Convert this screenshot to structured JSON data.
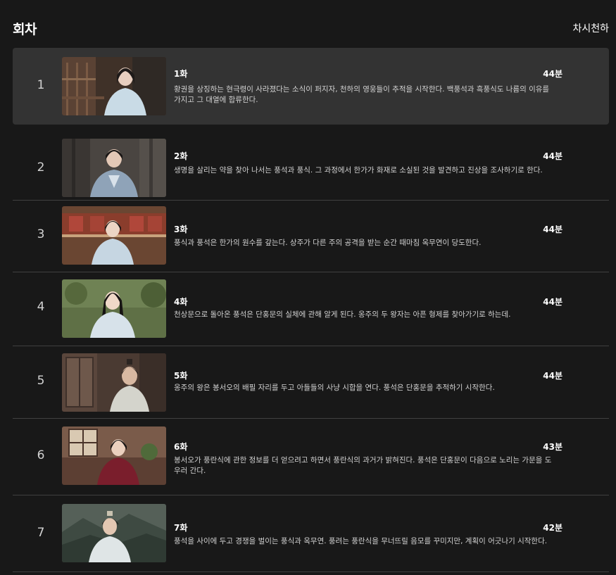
{
  "header": {
    "title": "회차",
    "show_title": "차시천하"
  },
  "episodes": [
    {
      "number": "1",
      "title": "1화",
      "duration": "44분",
      "description": "황권을 상징하는 현극령이 사라졌다는 소식이 퍼지자, 천하의 영웅들이 추적을 시작한다. 백풍석과 흑풍식도 나름의 이유를 가지고 그 대열에 합류한다.",
      "thumbnail": "woman-in-light-blue-robe-on-wooden-veranda"
    },
    {
      "number": "2",
      "title": "2화",
      "duration": "44분",
      "description": "생명을 살리는 약을 찾아 나서는 풍석과 풍식. 그 과정에서 한가가 화재로 소실된 것을 발견하고 진상을 조사하기로 한다.",
      "thumbnail": "man-in-grey-blue-robe-in-forest"
    },
    {
      "number": "3",
      "title": "3화",
      "duration": "44분",
      "description": "풍식과 풍석은 한가의 원수를 갚는다. 상주가 다른 주의 공격을 받는 순간 때마침 옥무연이 당도한다.",
      "thumbnail": "woman-in-light-blue-robe-before-red-building"
    },
    {
      "number": "4",
      "title": "4화",
      "duration": "44분",
      "description": "천상문으로 돌아온 풍석은 단홍문의 실체에 관해 알게 된다. 옹주의 두 왕자는 아픈 형제를 찾아가기로 하는데.",
      "thumbnail": "smiling-woman-outdoors-in-green-field"
    },
    {
      "number": "5",
      "title": "5화",
      "duration": "44분",
      "description": "옹주의 왕은 봉서오의 배필 자리를 두고 아들들의 사냥 시합을 연다. 풍석은 단홍문을 추적하기 시작한다.",
      "thumbnail": "older-man-in-white-robe-indoors"
    },
    {
      "number": "6",
      "title": "6화",
      "duration": "43분",
      "description": "봉서오가 풍란식에 관한 정보를 더 얻으려고 하면서 풍란식의 과거가 밝혀진다. 풍석은 단홍문이 다음으로 노리는 가문을 도우러 간다.",
      "thumbnail": "woman-in-red-robe-in-hall"
    },
    {
      "number": "7",
      "title": "7화",
      "duration": "42분",
      "description": "풍석을 사이에 두고 경쟁을 벌이는 풍식과 옥무연. 풍려는 풍란식을 무너뜨릴 음모를 꾸미지만, 계획이 어긋나기 시작한다.",
      "thumbnail": "man-in-white-robe-before-misty-mountains"
    }
  ]
}
